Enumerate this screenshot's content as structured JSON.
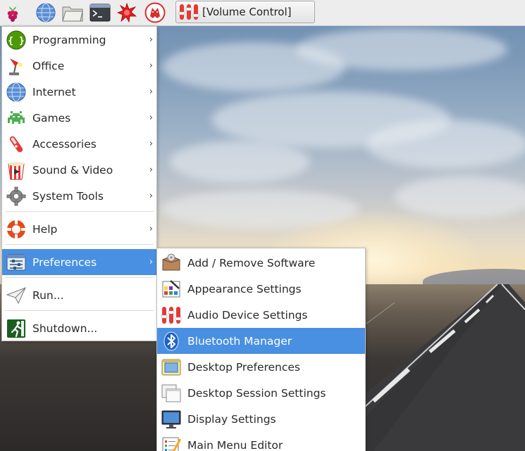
{
  "taskbar": {
    "launchers": [
      {
        "icon": "raspberry-menu-icon"
      },
      {
        "icon": "web-browser-icon"
      },
      {
        "icon": "file-manager-icon"
      },
      {
        "icon": "terminal-icon"
      },
      {
        "icon": "mathematica-icon"
      },
      {
        "icon": "wolfram-icon"
      }
    ],
    "task_button": {
      "icon": "volume-control-icon",
      "label": "[Volume Control]"
    }
  },
  "main_menu": {
    "items": [
      {
        "label": "Programming",
        "icon": "programming-icon",
        "has_submenu": true
      },
      {
        "label": "Office",
        "icon": "office-icon",
        "has_submenu": true
      },
      {
        "label": "Internet",
        "icon": "internet-icon",
        "has_submenu": true
      },
      {
        "label": "Games",
        "icon": "games-icon",
        "has_submenu": true
      },
      {
        "label": "Accessories",
        "icon": "accessories-icon",
        "has_submenu": true
      },
      {
        "label": "Sound & Video",
        "icon": "sound-video-icon",
        "has_submenu": true
      },
      {
        "label": "System Tools",
        "icon": "system-tools-icon",
        "has_submenu": true
      },
      {
        "label": "Help",
        "icon": "help-icon",
        "has_submenu": true
      },
      {
        "label": "Preferences",
        "icon": "preferences-icon",
        "has_submenu": true,
        "selected": true
      },
      {
        "label": "Run...",
        "icon": "run-icon",
        "has_submenu": false
      },
      {
        "label": "Shutdown...",
        "icon": "shutdown-icon",
        "has_submenu": false
      }
    ],
    "submenu_arrow": "›"
  },
  "preferences_menu": {
    "items": [
      {
        "label": "Add / Remove Software",
        "icon": "add-remove-software-icon"
      },
      {
        "label": "Appearance Settings",
        "icon": "appearance-settings-icon"
      },
      {
        "label": "Audio Device Settings",
        "icon": "audio-device-settings-icon"
      },
      {
        "label": "Bluetooth Manager",
        "icon": "bluetooth-icon",
        "selected": true
      },
      {
        "label": "Desktop Preferences",
        "icon": "desktop-preferences-icon"
      },
      {
        "label": "Desktop Session Settings",
        "icon": "desktop-session-settings-icon"
      },
      {
        "label": "Display Settings",
        "icon": "display-settings-icon"
      },
      {
        "label": "Main Menu Editor",
        "icon": "main-menu-editor-icon"
      }
    ]
  },
  "colors": {
    "selection": "#4a90e2",
    "panel": "#ededed",
    "menu_background": "#ffffff"
  }
}
